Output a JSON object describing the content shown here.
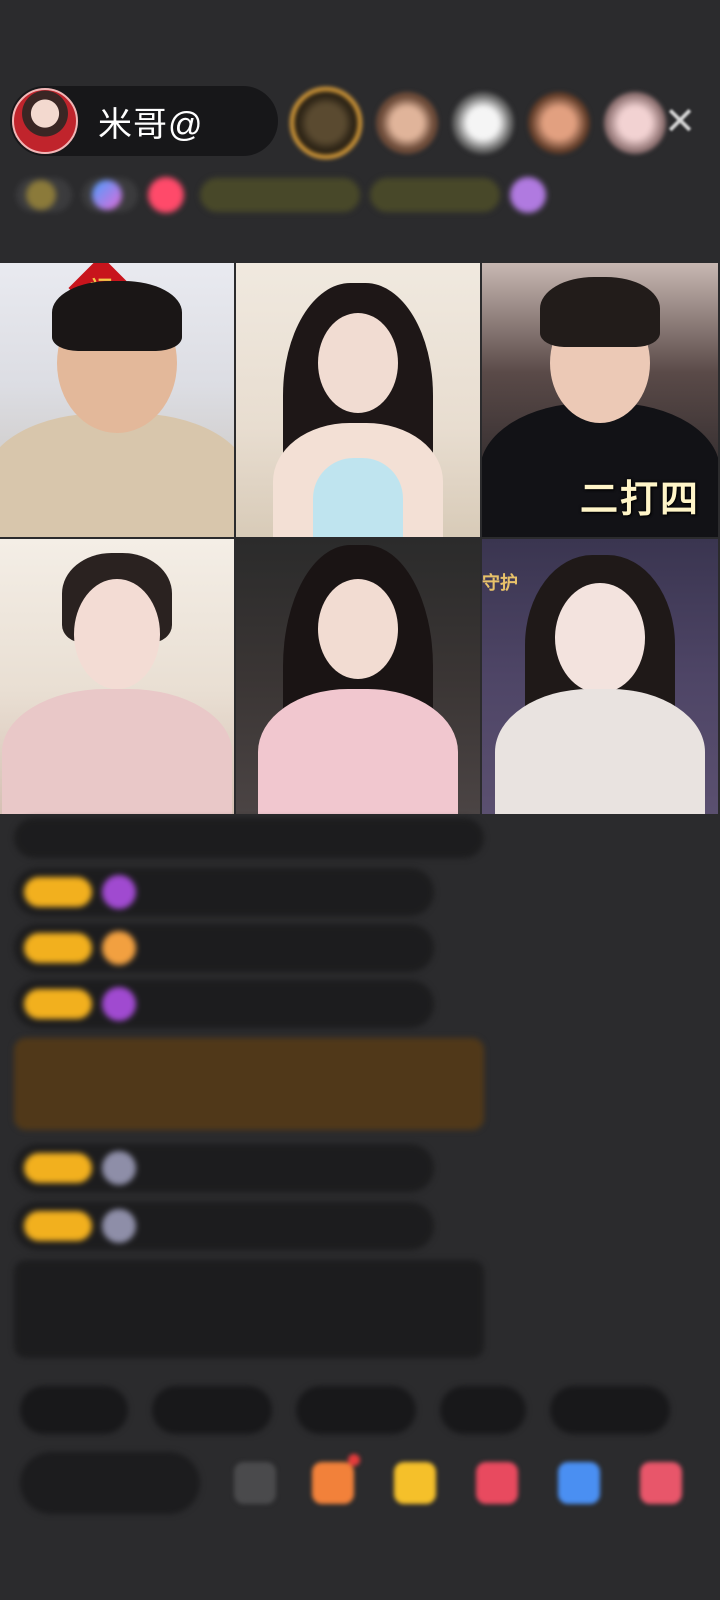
{
  "header": {
    "host_name": "米哥@",
    "close_glyph": "✕",
    "viewer_colors": [
      "#8a5a2a",
      "#7a5040",
      "#b0b0b0",
      "#8b5a3c",
      "#c7a9a9"
    ],
    "info_chips": [
      "",
      "",
      "",
      "",
      "",
      ""
    ]
  },
  "video_tiles": [
    {
      "caption": "",
      "tag": "",
      "fu_char": "福"
    },
    {
      "caption": "",
      "tag": ""
    },
    {
      "caption": "二打四",
      "tag": ""
    },
    {
      "caption": "",
      "tag": ""
    },
    {
      "caption": "",
      "tag": ""
    },
    {
      "caption": "",
      "tag": "守护"
    }
  ],
  "chat": {
    "messages": [
      {
        "name": "",
        "text": ""
      },
      {
        "name": "",
        "text": ""
      },
      {
        "name": "",
        "text": ""
      },
      {
        "name": "",
        "text": ""
      },
      {
        "name": "",
        "text": ""
      },
      {
        "name": "",
        "text": ""
      },
      {
        "name": "",
        "text": ""
      },
      {
        "name": "",
        "text": ""
      }
    ]
  },
  "bottom": {
    "quick_replies": [
      "",
      "",
      "",
      "",
      ""
    ],
    "input_placeholder": ""
  },
  "colors": {
    "background": "#2b2b2d",
    "badge": "#f2b01e",
    "caption": "#fff5c8",
    "green_text": "#7fc35a"
  }
}
